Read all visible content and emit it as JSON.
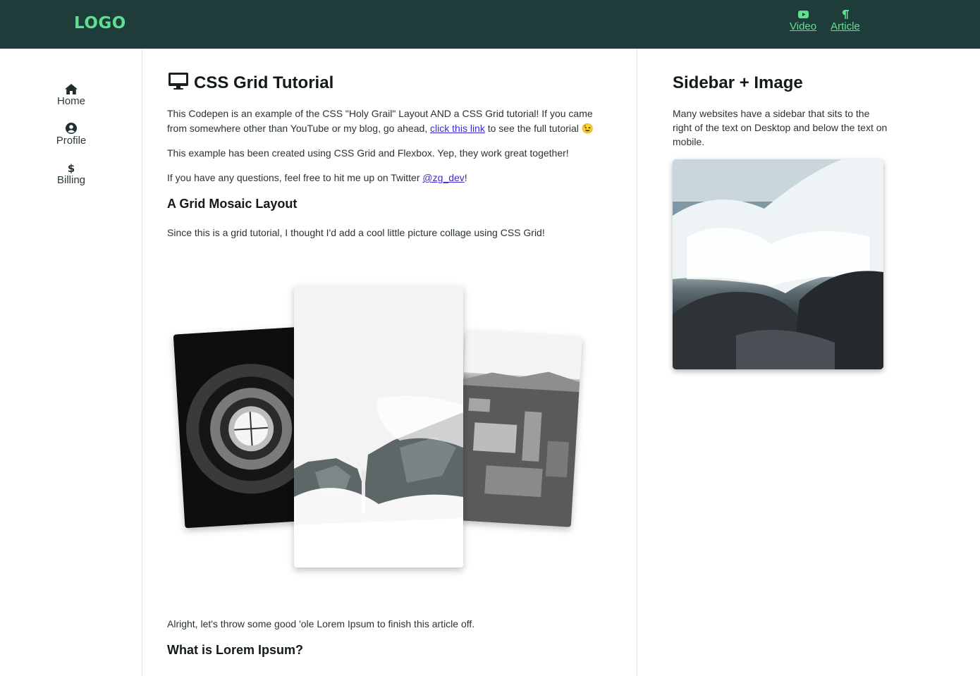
{
  "header": {
    "logo": "LOGO",
    "nav": [
      {
        "label": "Video",
        "icon": "youtube-icon"
      },
      {
        "label": "Article",
        "icon": "paragraph-icon"
      }
    ]
  },
  "sidebar_left": {
    "items": [
      {
        "label": "Home",
        "icon": "home-icon"
      },
      {
        "label": "Profile",
        "icon": "user-circle-icon"
      },
      {
        "label": "Billing",
        "icon": "dollar-icon"
      }
    ]
  },
  "main": {
    "title": "CSS Grid Tutorial",
    "title_icon": "desktop-icon",
    "intro": {
      "before_link": "This Codepen is an example of the CSS \"Holy Grail\" Layout AND a CSS Grid tutorial! If you came from somewhere other than YouTube or my blog, go ahead, ",
      "link": "click this link",
      "after_link": " to see the full tutorial 😉"
    },
    "p2": "This example has been created using CSS Grid and Flexbox. Yep, they work great together!",
    "p3": {
      "before_link": "If you have any questions, feel free to hit me up on Twitter ",
      "link": "@zg_dev",
      "after_link": "!"
    },
    "h_mosaic": "A Grid Mosaic Layout",
    "p_mosaic": "Since this is a grid tutorial, I thought I'd add a cool little picture collage using CSS Grid!",
    "mosaic_images": [
      "spiral-staircase-photo",
      "waterfall-fog-photo",
      "city-aerial-photo"
    ],
    "p_lorem_intro": "Alright, let's throw some good 'ole Lorem Ipsum to finish this article off.",
    "h_lorem": "What is Lorem Ipsum?"
  },
  "sidebar_right": {
    "title": "Sidebar + Image",
    "text": "Many websites have a sidebar that sits to the right of the text on Desktop and below the text on mobile.",
    "image": "ocean-wave-rocks-photo"
  },
  "colors": {
    "header_bg": "#1e3d3a",
    "accent": "#5ee08e",
    "link": "#3b2bc9"
  }
}
